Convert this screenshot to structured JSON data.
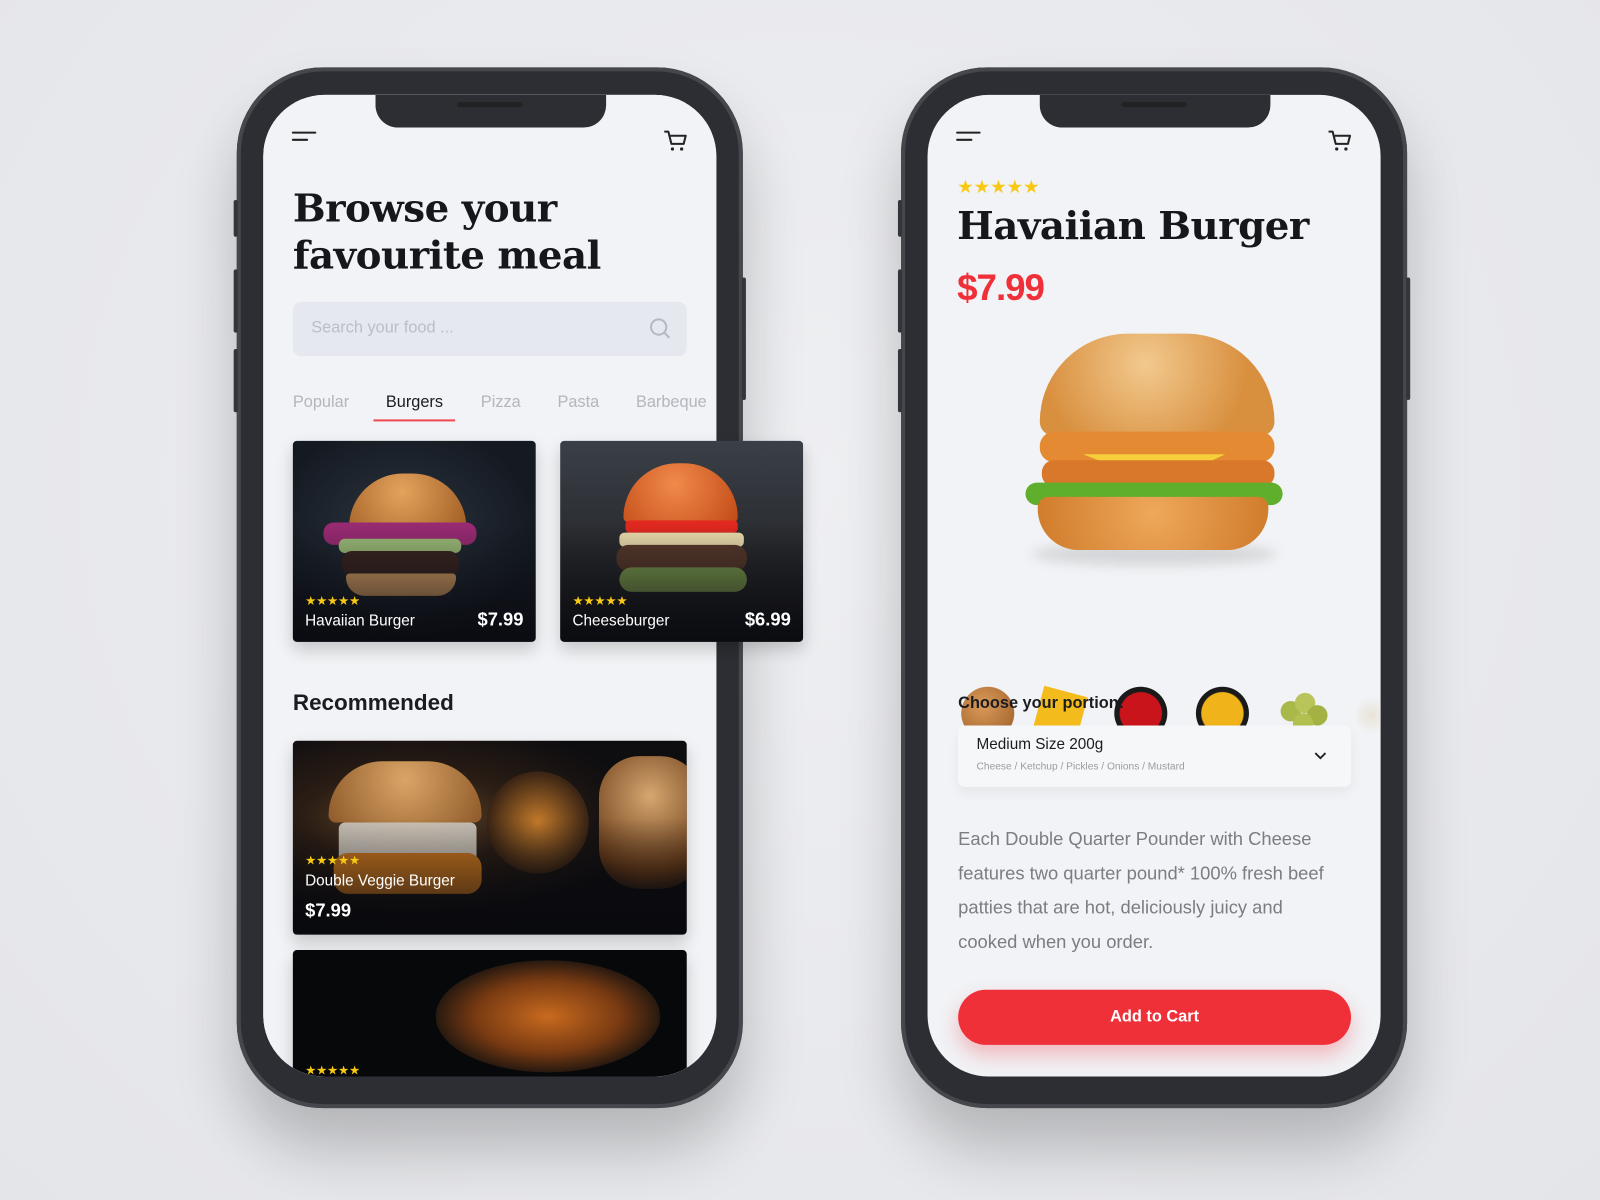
{
  "browse": {
    "title_line1": "Browse your",
    "title_line2": "favourite meal",
    "search_placeholder": "Search your food ...",
    "tabs": [
      {
        "label": "Popular",
        "active": false
      },
      {
        "label": "Burgers",
        "active": true
      },
      {
        "label": "Pizza",
        "active": false
      },
      {
        "label": "Pasta",
        "active": false
      },
      {
        "label": "Barbeque",
        "active": false
      }
    ],
    "cards": [
      {
        "name": "Havaiian Burger",
        "price": "$7.99",
        "stars": "★★★★★",
        "rating": 5
      },
      {
        "name": "Cheeseburger",
        "price": "$6.99",
        "stars": "★★★★★",
        "rating": 5
      }
    ],
    "recommended_title": "Recommended",
    "recommended": [
      {
        "name": "Double Veggie Burger",
        "price": "$7.99",
        "stars": "★★★★★",
        "rating": 5
      },
      {
        "stars": "★★★★★",
        "rating": 5
      }
    ]
  },
  "detail": {
    "stars": "★★★★★",
    "rating": 5,
    "title": "Havaiian Burger",
    "price": "$7.99",
    "ingredients": [
      "bun",
      "cheese",
      "ketchup",
      "mustard",
      "pickles",
      "onions"
    ],
    "portion_label": "Choose your portion:",
    "portion_value": "Medium Size 200g",
    "portion_toppings": "Cheese / Ketchup / Pickles / Onions / Mustard",
    "description": "Each Double Quarter Pounder with Cheese features two quarter pound* 100% fresh beef patties that are hot, deliciously juicy and cooked when you order.",
    "add_to_cart": "Add to Cart"
  },
  "colors": {
    "accent": "#ef3039",
    "star": "#f7c914",
    "text": "#16171b",
    "background": "#f1f3f6"
  }
}
